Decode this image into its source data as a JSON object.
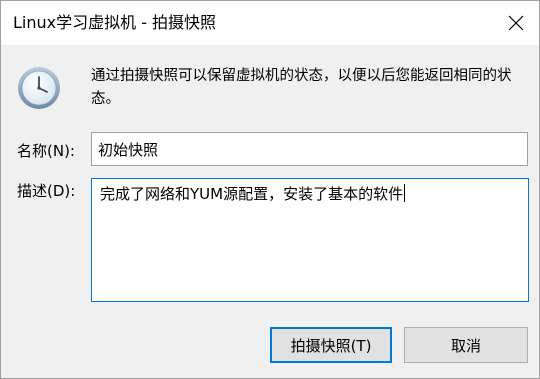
{
  "window": {
    "title": "Linux学习虚拟机 - 拍摄快照"
  },
  "info": {
    "description": "通过拍摄快照可以保留虚拟机的状态，以便以后您能返回相同的状态。",
    "icon": "clock-icon"
  },
  "form": {
    "name_label": "名称(N):",
    "name_value": "初始快照",
    "description_label": "描述(D):",
    "description_value": "完成了网络和YUM源配置，安装了基本的软件"
  },
  "buttons": {
    "take_snapshot": "拍摄快照(T)",
    "cancel": "取消"
  },
  "colors": {
    "accent": "#0078d7",
    "dialog_background": "#f0f0f0",
    "button_background": "#e1e1e1"
  }
}
